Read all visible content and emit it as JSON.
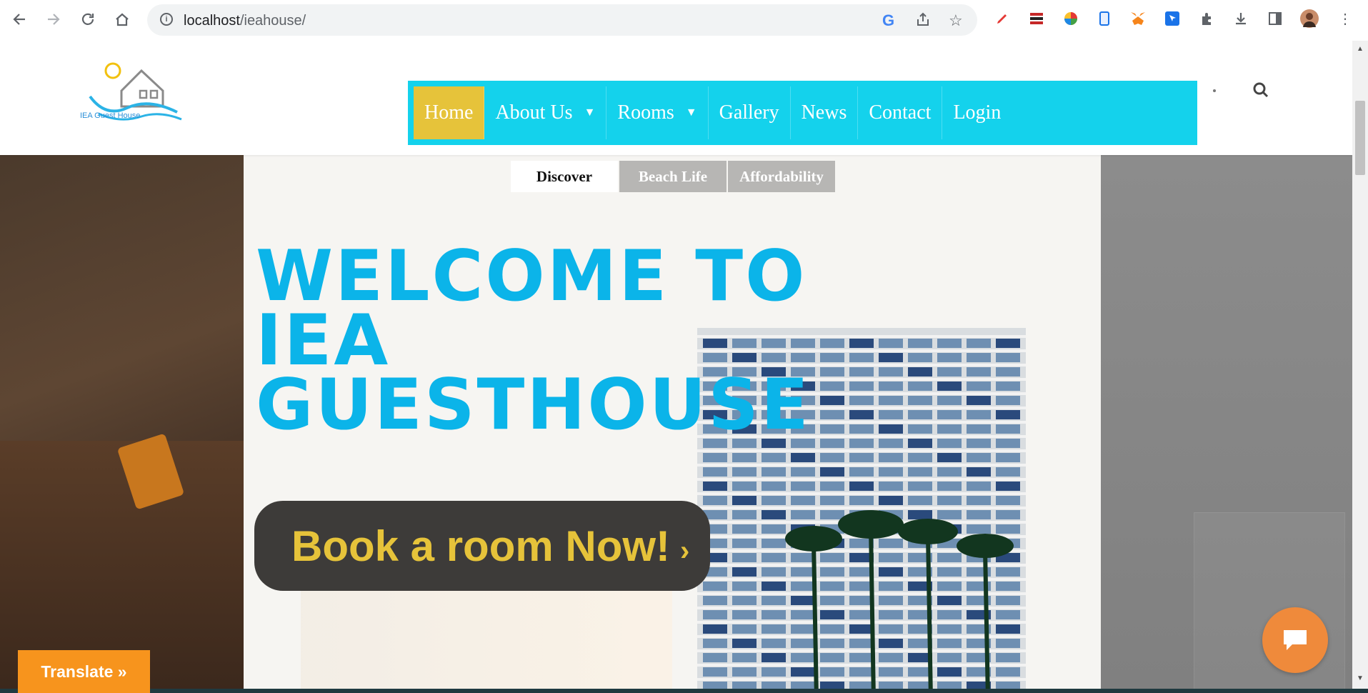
{
  "browser": {
    "url_host": "localhost",
    "url_path": "/ieahouse/"
  },
  "site": {
    "logo_text": "IEA Guest House",
    "nav": [
      {
        "label": "Home",
        "active": true
      },
      {
        "label": "About Us",
        "dropdown": true
      },
      {
        "label": "Rooms",
        "dropdown": true
      },
      {
        "label": "Gallery"
      },
      {
        "label": "News"
      },
      {
        "label": "Contact"
      },
      {
        "label": "Login"
      }
    ]
  },
  "hero": {
    "tabs": [
      "Discover",
      "Beach Life",
      "Affordability"
    ],
    "headline_lines": [
      "WELCOME TO",
      "IEA",
      "GUESTHOUSE"
    ],
    "cta_label": "Book a room Now!",
    "cta_arrow": "›"
  },
  "widgets": {
    "translate_label": "Translate »"
  },
  "colors": {
    "nav_bg": "#14d2ec",
    "nav_active": "#e6c33a",
    "headline": "#0bb4e9",
    "cta_bg": "#3d3b39",
    "cta_text": "#e6c33a",
    "translate_bg": "#f7941d",
    "chat_bg": "#ef8a3b"
  },
  "icons": {
    "browser": [
      "back-arrow-icon",
      "forward-arrow-icon",
      "reload-icon",
      "home-icon",
      "site-info-icon",
      "google-icon",
      "share-icon",
      "bookmark-star-icon",
      "extensions-icon",
      "download-icon",
      "sidebar-icon",
      "profile-avatar",
      "menu-kebab-icon"
    ],
    "site": [
      "search-icon",
      "chat-icon",
      "dropdown-caret-icon"
    ]
  }
}
